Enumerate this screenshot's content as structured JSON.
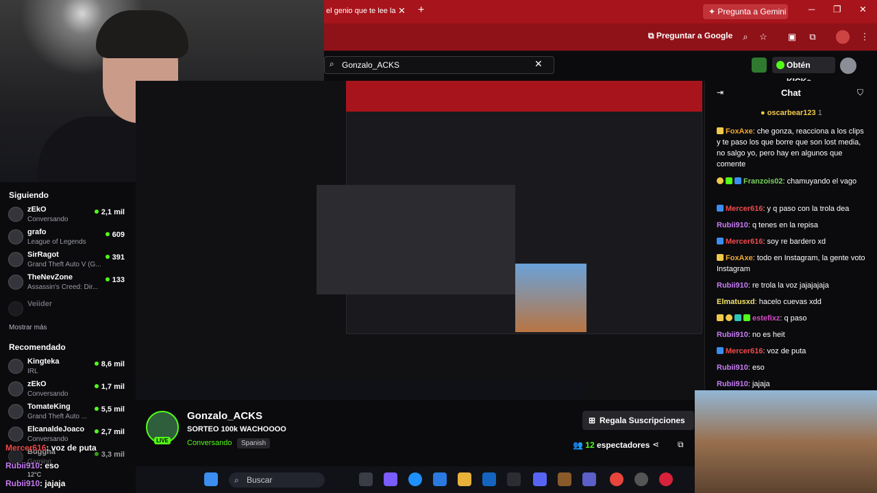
{
  "browser": {
    "tab_title": "el genio que te lee la",
    "gemini_label": "Pregunta a Gemini",
    "ask_google_label": "Preguntar a Google"
  },
  "search": {
    "value": "Gonzalo_ACKS"
  },
  "header": {
    "get_kicks_label": "Obtén KICKs"
  },
  "sidebar": {
    "following_heading": "Siguiendo",
    "following": [
      {
        "name": "zEkO",
        "game": "Conversando",
        "count": "2,1 mil"
      },
      {
        "name": "grafo",
        "game": "League of Legends",
        "count": "609"
      },
      {
        "name": "SirRagot",
        "game": "Grand Theft Auto V (G...",
        "count": "391"
      },
      {
        "name": "TheNevZone",
        "game": "Assassin's Creed: Dir...",
        "count": "133"
      }
    ],
    "offline": "Veiider",
    "show_more": "Mostrar más",
    "recommended_heading": "Recomendado",
    "recommended": [
      {
        "name": "Kingteka",
        "game": "IRL",
        "count": "8,6 mil"
      },
      {
        "name": "zEkO",
        "game": "Conversando",
        "count": "1,7 mil"
      },
      {
        "name": "TomateKing",
        "game": "Grand Theft Auto ...",
        "count": "5,5 mil"
      },
      {
        "name": "ElcanaldeJoaco",
        "game": "Conversando",
        "count": "2,7 mil"
      },
      {
        "name": "Buggha",
        "game": "Gaming",
        "count": "3,3 mil"
      }
    ]
  },
  "stream": {
    "name": "Gonzalo_ACKS",
    "title": "SORTEO 100k WACHOOOO",
    "category": "Conversando",
    "language": "Spanish",
    "live": "LIVE",
    "viewers": "12",
    "viewers_label": "espectadores",
    "gift_label": "Regala Suscripciones"
  },
  "chat": {
    "title": "Chat",
    "pinned_user": "oscarbear123",
    "pinned_count": "1",
    "messages": [
      {
        "user": "FoxAxe",
        "text": ": che gonza, reacciona a los clips y te paso los que borre que son lost media, no salgo yo, pero hay en algunos que comente",
        "color": "#f0a830"
      },
      {
        "user": "Franzois02",
        "text": ": chamuyando el vago",
        "color": "#7bd35f"
      },
      {
        "user": "Mercer616",
        "text": ": y q paso con la trola dea",
        "color": "#f14a4a"
      },
      {
        "user": "Rubii910",
        "text": ": q tenes en la repisa",
        "color": "#c77df2"
      },
      {
        "user": "Mercer616",
        "text": ": soy re bardero xd",
        "color": "#f14a4a"
      },
      {
        "user": "FoxAxe",
        "text": ": todo en Instagram, la gente voto Instagram",
        "color": "#f0a830"
      },
      {
        "user": "Rubii910",
        "text": ": re trola la voz jajajajaja",
        "color": "#c77df2"
      },
      {
        "user": "Elmatusxd",
        "text": ": hacelo cuevas xdd",
        "color": "#f3e36b"
      },
      {
        "user": "estefixz",
        "text": ": q paso",
        "color": "#d64ac7"
      },
      {
        "user": "Rubii910",
        "text": ": no es heit",
        "color": "#c77df2"
      },
      {
        "user": "Mercer616",
        "text": ": voz de puta",
        "color": "#f14a4a"
      },
      {
        "user": "Rubii910",
        "text": ": eso",
        "color": "#c77df2"
      },
      {
        "user": "Rubii910",
        "text": ": jajaja",
        "color": "#c77df2"
      }
    ]
  },
  "overlay_chat": [
    {
      "user": "Mercer616",
      "text": ": voz de puta"
    },
    {
      "user": "Rubii910",
      "text": ": eso"
    },
    {
      "user": "Rubii910",
      "text": ": jajaja"
    }
  ],
  "taskbar": {
    "search_label": "Buscar",
    "temp": "12°C"
  }
}
